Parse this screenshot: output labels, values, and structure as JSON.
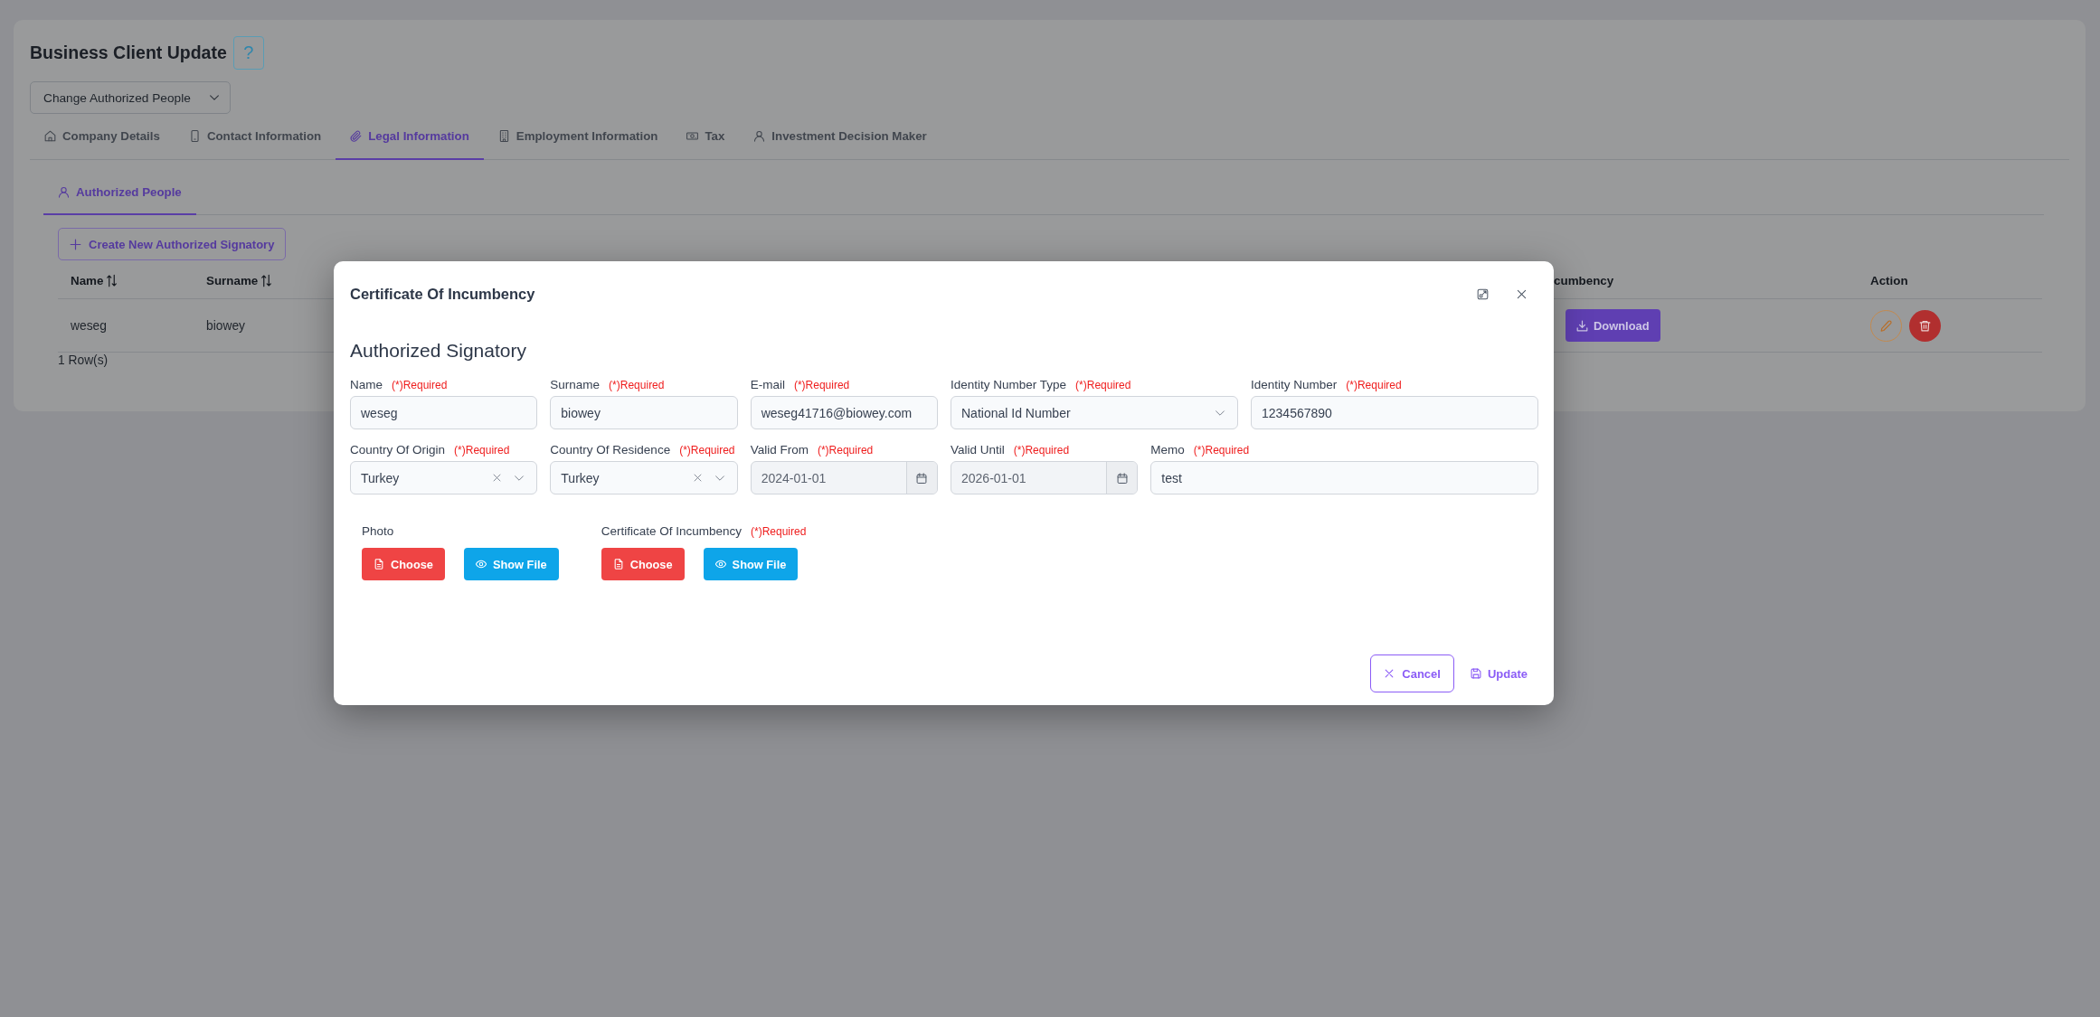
{
  "header": {
    "title": "Business Client Update",
    "help_button": "?",
    "action_select": {
      "value": "Change Authorized People"
    }
  },
  "tabs": [
    {
      "label": "Company Details",
      "selected": false
    },
    {
      "label": "Contact Information",
      "selected": false
    },
    {
      "label": "Legal Information",
      "selected": true
    },
    {
      "label": "Employment Information",
      "selected": false
    },
    {
      "label": "Tax",
      "selected": false
    },
    {
      "label": "Investment Decision Maker",
      "selected": false
    }
  ],
  "subtabs": [
    {
      "label": "Authorized People",
      "selected": true
    }
  ],
  "create_button": "Create New Authorized Signatory",
  "table": {
    "columns": [
      {
        "label": "Name",
        "sortable": true
      },
      {
        "label": "Surname",
        "sortable": true
      },
      {
        "label": "cumbency",
        "sortable": false
      },
      {
        "label": "Action",
        "sortable": false
      }
    ],
    "rows": [
      {
        "name": "weseg",
        "surname": "biowey",
        "download_button": "Download"
      }
    ],
    "row_count": "1 Row(s)"
  },
  "modal": {
    "title": "Certificate Of Incumbency",
    "section_title": "Authorized Signatory",
    "fields": [
      {
        "kind": "text",
        "label": "Name",
        "required_note": "(*)Required",
        "value": "weseg"
      },
      {
        "kind": "text",
        "label": "Surname",
        "required_note": "(*)Required",
        "value": "biowey"
      },
      {
        "kind": "text",
        "label": "E-mail",
        "required_note": "(*)Required",
        "value": "weseg41716@biowey.com"
      },
      {
        "kind": "select",
        "label": "Identity Number Type",
        "required_note": "(*)Required",
        "value": "National Id Number",
        "clearable": false
      },
      {
        "kind": "text",
        "label": "Identity Number",
        "required_note": "(*)Required",
        "value": "1234567890"
      },
      {
        "kind": "select",
        "label": "Country Of Origin",
        "required_note": "(*)Required",
        "value": "Turkey",
        "clearable": true
      },
      {
        "kind": "select",
        "label": "Country Of Residence",
        "required_note": "(*)Required",
        "value": "Turkey",
        "clearable": true
      },
      {
        "kind": "date",
        "label": "Valid From",
        "required_note": "(*)Required",
        "value": "2024-01-01"
      },
      {
        "kind": "date",
        "label": "Valid Until",
        "required_note": "(*)Required",
        "value": "2026-01-01"
      },
      {
        "kind": "text",
        "label": "Memo",
        "required_note": "(*)Required",
        "value": "test"
      }
    ],
    "uploads": [
      {
        "label": "Photo",
        "choose_button": "Choose",
        "show_button": "Show File"
      },
      {
        "label": "Certificate Of Incumbency",
        "required_note": "(*)Required",
        "choose_button": "Choose",
        "show_button": "Show File"
      }
    ],
    "cancel_button": "Cancel",
    "update_button": "Update"
  }
}
